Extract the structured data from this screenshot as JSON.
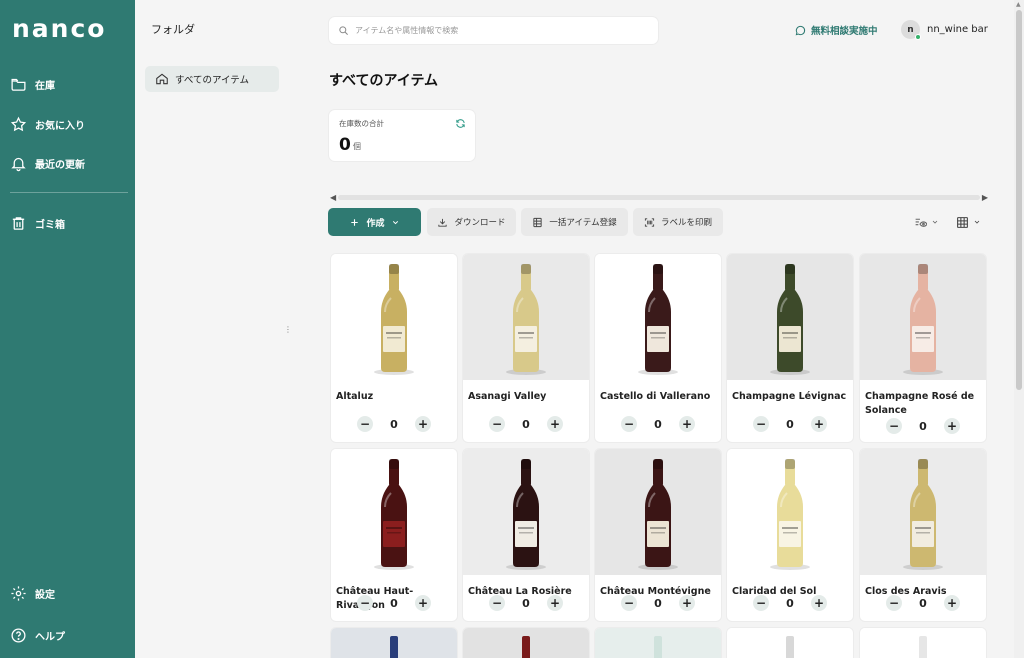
{
  "app": {
    "logo": "nanco"
  },
  "nav": {
    "items": [
      {
        "label": "在庫",
        "icon": "folder-icon"
      },
      {
        "label": "お気に入り",
        "icon": "star-icon"
      },
      {
        "label": "最近の更新",
        "icon": "bell-icon"
      },
      {
        "label": "ゴミ箱",
        "icon": "trash-icon"
      }
    ],
    "bottom": [
      {
        "label": "設定",
        "icon": "gear-icon"
      },
      {
        "label": "ヘルプ",
        "icon": "help-icon"
      }
    ],
    "accent": "#2f7a72"
  },
  "folder": {
    "title": "フォルダ",
    "items": [
      {
        "label": "すべてのアイテム",
        "icon": "home-icon"
      }
    ]
  },
  "header": {
    "search_placeholder": "アイテム名や属性情報で検索",
    "consult": "無料相談実施中",
    "user_initial": "n",
    "user_name": "nn_wine bar"
  },
  "main": {
    "title": "すべてのアイテム",
    "stock": {
      "label": "在庫数の合計",
      "value": "0",
      "unit": "個"
    }
  },
  "toolbar": {
    "create": "作成",
    "download": "ダウンロード",
    "bulk": "一括アイテム登録",
    "print": "ラベルを印刷"
  },
  "items": [
    {
      "name": "Altaluz",
      "qty": "0",
      "bottle": "#c8b062",
      "label": "#f1ead2",
      "bg": "#ffffff"
    },
    {
      "name": "Asanagi Valley",
      "qty": "0",
      "bottle": "#d8c98a",
      "label": "#f4efe0",
      "bg": "#e9e9e9"
    },
    {
      "name": "Castello di Vallerano",
      "qty": "0",
      "bottle": "#3a1a1a",
      "label": "#efe7dc",
      "bg": "#ffffff"
    },
    {
      "name": "Champagne Lévignac",
      "qty": "0",
      "bottle": "#3d4a2a",
      "label": "#ece6d2",
      "bg": "#e6e6e6"
    },
    {
      "name": "Champagne Rosé de Solance",
      "qty": "0",
      "bottle": "#e5b3a2",
      "label": "#f7ece6",
      "bg": "#e7e7e7"
    },
    {
      "name": "Château Haut-Rivançon",
      "qty": "0",
      "bottle": "#4a1212",
      "label": "#8b1e1e",
      "bg": "#ffffff"
    },
    {
      "name": "Château La Rosière",
      "qty": "0",
      "bottle": "#2b1212",
      "label": "#f0ece4",
      "bg": "#ececec"
    },
    {
      "name": "Château Montévigne",
      "qty": "0",
      "bottle": "#3b1515",
      "label": "#ece4d4",
      "bg": "#e6e6e6"
    },
    {
      "name": "Claridad del Sol",
      "qty": "0",
      "bottle": "#e8dc9a",
      "label": "#f8f4e4",
      "bg": "#ffffff"
    },
    {
      "name": "Clos des Aravis",
      "qty": "0",
      "bottle": "#cdb870",
      "label": "#f1ece0",
      "bg": "#ebebeb"
    }
  ]
}
